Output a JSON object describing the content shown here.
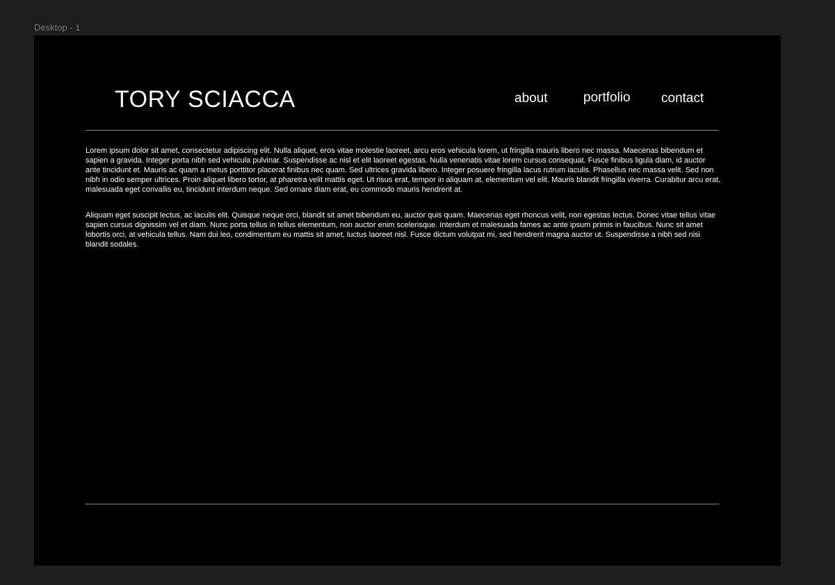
{
  "canvas": {
    "frame_label": "Desktop - 1"
  },
  "header": {
    "name_first": "TORY",
    "name_last": "SCIACCA",
    "nav": {
      "about": "about",
      "portfolio": "portfolio",
      "contact": "contact"
    }
  },
  "content": {
    "paragraphs": [
      "Lorem ipsum dolor sit amet, consectetur adipiscing elit. Nulla aliquet, eros vitae molestie laoreet, arcu eros vehicula lorem, ut fringilla mauris libero nec massa. Maecenas bibendum et sapien a gravida. Integer porta nibh sed vehicula pulvinar. Suspendisse ac nisl et elit laoreet egestas. Nulla venenatis vitae lorem cursus consequat. Fusce finibus ligula diam, id auctor ante tincidunt et. Mauris ac quam a metus porttitor placerat finibus nec quam. Sed ultrices gravida libero. Integer posuere fringilla lacus rutrum iaculis. Phasellus nec massa velit. Sed non nibh in odio semper ultrices. Proin aliquet libero tortor, at pharetra velit mattis eget. Ut risus erat, tempor in aliquam at, elementum vel elit. Mauris blandit fringilla viverra. Curabitur arcu erat, malesuada eget convallis eu, tincidunt interdum neque. Sed ornare diam erat, eu commodo mauris hendrerit at.",
      "Aliquam eget suscipit lectus, ac iaculis elit. Quisque neque orci, blandit sit amet bibendum eu, auctor quis quam. Maecenas eget rhoncus velit, non egestas lectus. Donec vitae tellus vitae sapien cursus dignissim vel et diam. Nunc porta tellus in tellus elementum, non auctor enim scelerisque. Interdum et malesuada fames ac ante ipsum primis in faucibus. Nunc sit amet lobortis orci, at vehicula tellus. Nam dui leo, condimentum eu mattis sit amet, luctus laoreet nisl. Fusce dictum volutpat mi, sed hendrerit magna auctor ut. Suspendisse a nibh sed nisi blandit sodales."
    ]
  },
  "colors": {
    "canvas_background": "#1e1e1e",
    "frame_background": "#000000",
    "text": "#ffffff",
    "divider": "#8a8a8a",
    "frame_label": "#7a7a7a"
  }
}
